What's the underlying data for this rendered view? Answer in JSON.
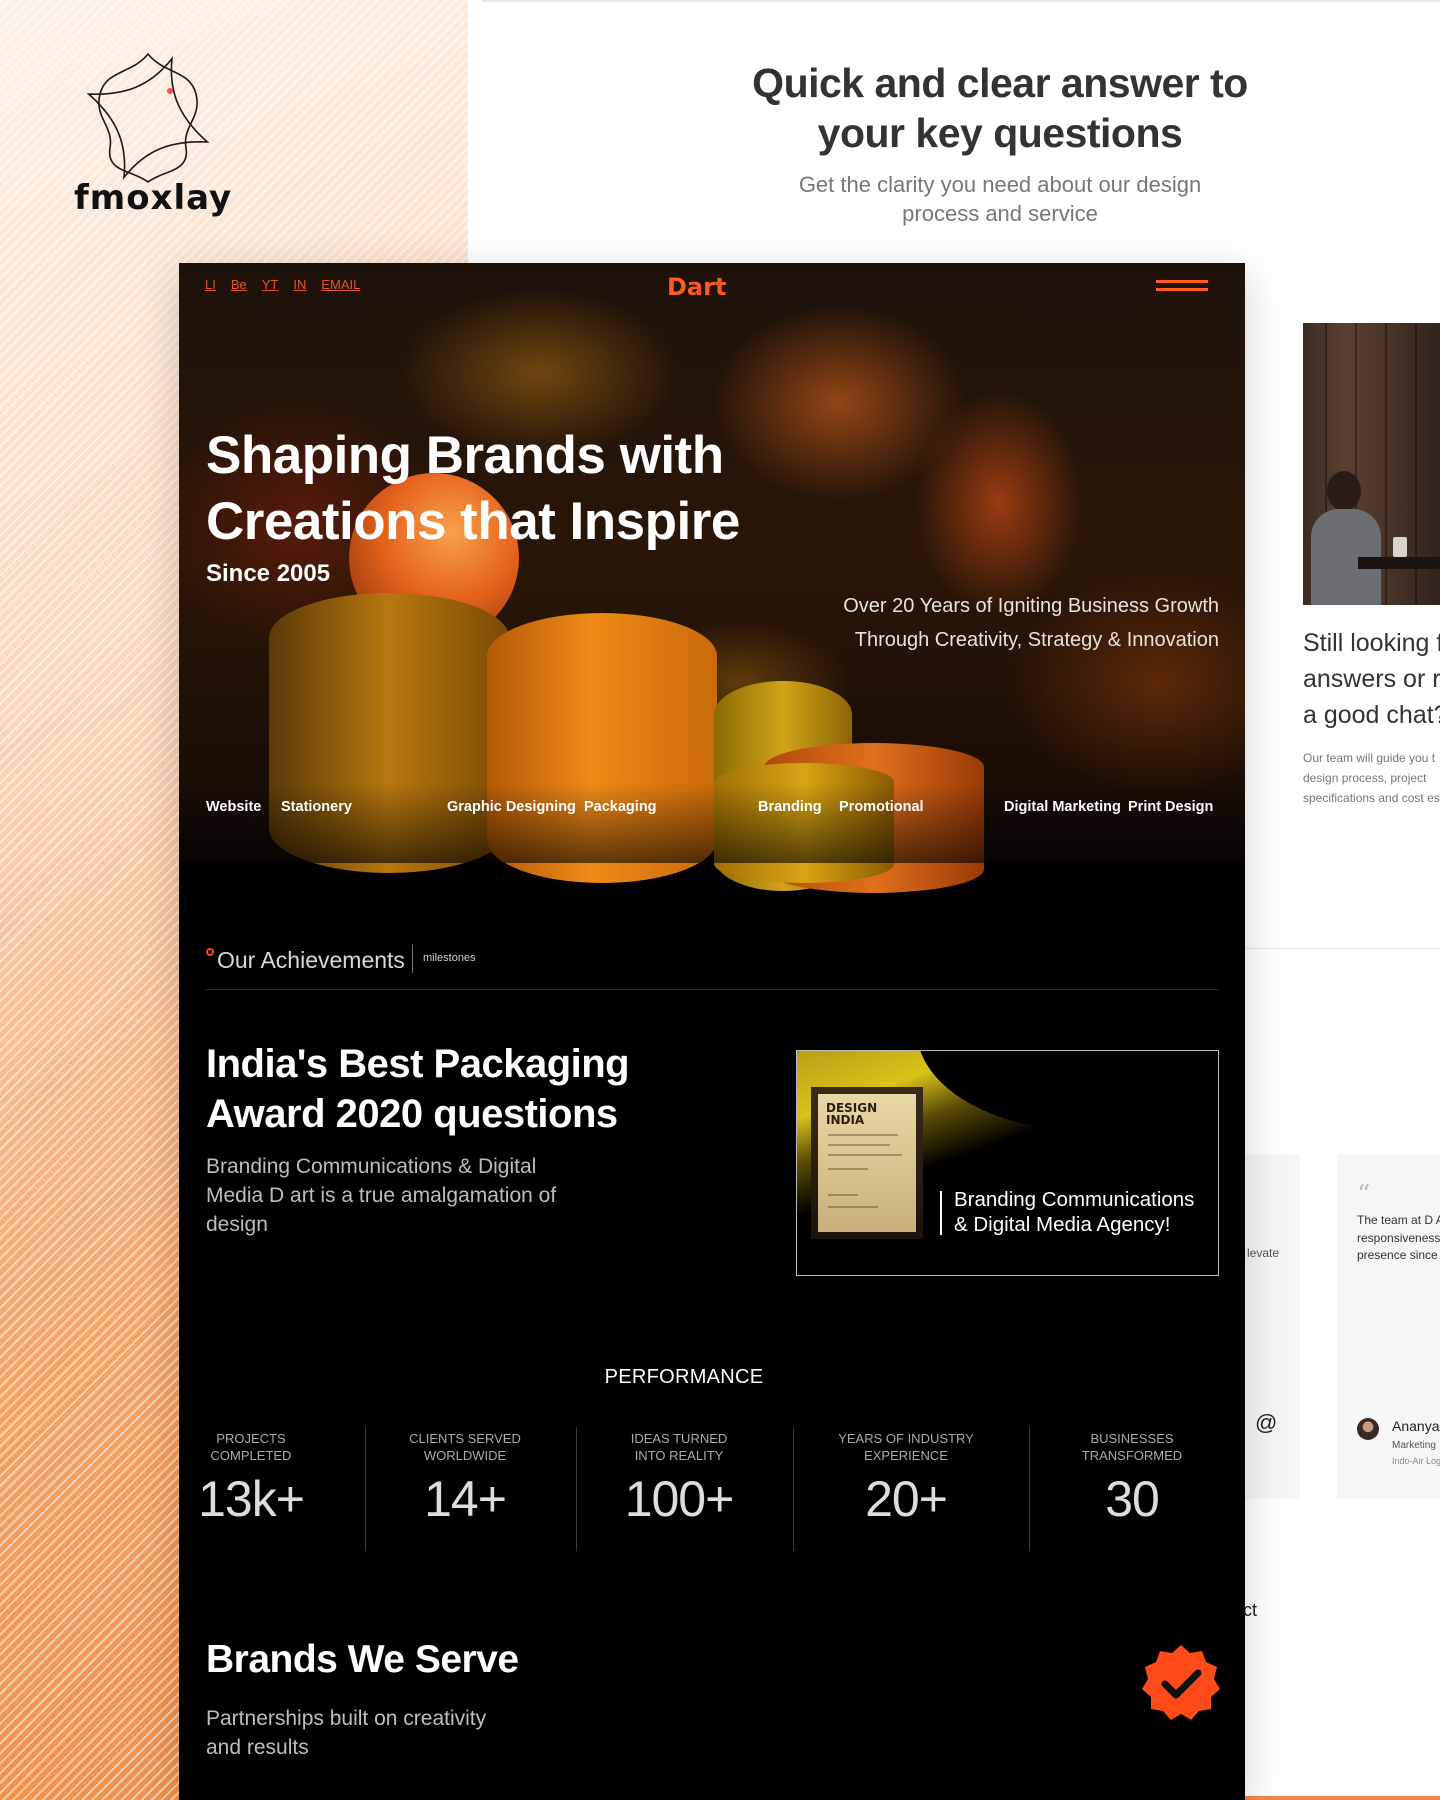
{
  "brand": {
    "name": "fmoxlay"
  },
  "faq": {
    "title_line1": "Quick and clear answer to",
    "title_line2": "your key questions",
    "subtitle_line1": "Get the clarity you need about our design",
    "subtitle_line2": "process and service"
  },
  "side": {
    "still_line1": "Still looking f",
    "still_line2": "answers or r",
    "still_line3": "a good chat?",
    "desc_line1": "Our team will guide you t",
    "desc_line2": "design process, project",
    "desc_line3": "specifications and cost es"
  },
  "testimonials": {
    "fragment": "levate",
    "text": "The team at D A with incredible responsiveness growth exceed digital presence since we partn",
    "author": "Ananya",
    "role": "Marketing",
    "company": "Indo-Air Log"
  },
  "contact_fragment": "ct",
  "site": {
    "logo": "Dart",
    "nav": [
      "LI",
      "Be",
      "YT",
      "IN",
      "EMAIL"
    ],
    "hero": {
      "title_line1": "Shaping Brands with",
      "title_line2": "Creations that Inspire",
      "since": "Since 2005",
      "tagline_line1": "Over 20 Years of Igniting Business Growth",
      "tagline_line2": "Through Creativity, Strategy & Innovation"
    },
    "services": [
      "Website",
      "Stationery",
      "Graphic Designing",
      "Packaging",
      "Branding",
      "Promotional",
      "Digital Marketing",
      "Print Design"
    ],
    "achievements": {
      "label": "Our Achievements",
      "tag": "milestones",
      "award_title_line1": "India's Best Packaging",
      "award_title_line2": "Award 2020 questions",
      "award_desc_line1": "Branding Communications & Digital",
      "award_desc_line2": "Media D art is a true amalgamation of",
      "award_desc_line3": "design",
      "plaque_text_line1": "DESIGN",
      "plaque_text_line2": "INDIA",
      "caption_line1": "Branding Communications",
      "caption_line2": "& Digital Media Agency!"
    },
    "performance": {
      "title": "PERFORMANCE",
      "stats": [
        {
          "label_line1": "PROJECTS",
          "label_line2": "COMPLETED",
          "value": "13k+"
        },
        {
          "label_line1": "CLIENTS SERVED",
          "label_line2": "WORLDWIDE",
          "value": "14+"
        },
        {
          "label_line1": "IDEAS TURNED",
          "label_line2": "INTO REALITY",
          "value": "100+"
        },
        {
          "label_line1": "YEARS OF INDUSTRY",
          "label_line2": "EXPERIENCE",
          "value": "20+"
        },
        {
          "label_line1": "BUSINESSES",
          "label_line2": "TRANSFORMED",
          "value": "30"
        }
      ]
    },
    "brands": {
      "title": "Brands We Serve",
      "subtitle_line1": "Partnerships built on creativity",
      "subtitle_line2": "and results"
    }
  },
  "colors": {
    "accent": "#ff5a1f",
    "dark_bg": "#000000",
    "gradient_orange": "#f08c45"
  }
}
